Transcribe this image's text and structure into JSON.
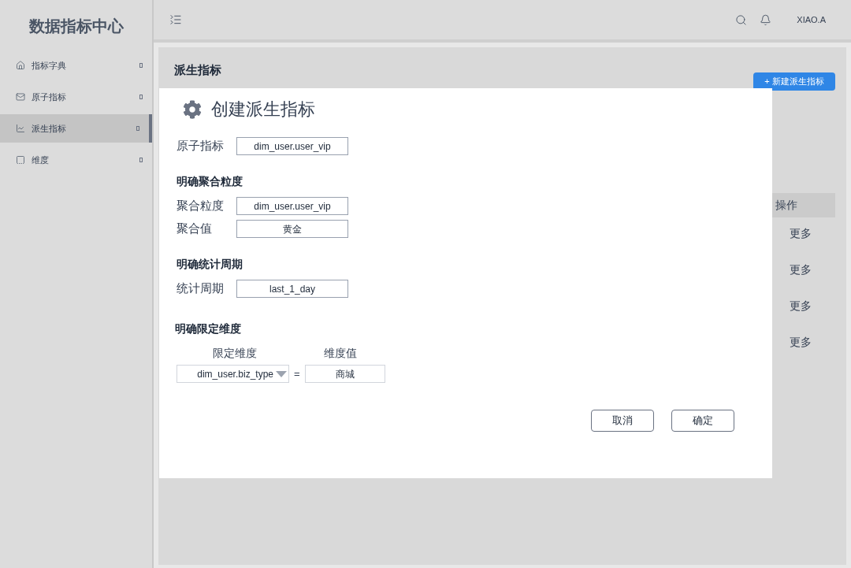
{
  "sidebar": {
    "title": "数据指标中心",
    "items": [
      {
        "label": "指标字典",
        "selected": false
      },
      {
        "label": "原子指标",
        "selected": false
      },
      {
        "label": "派生指标",
        "selected": true
      },
      {
        "label": "维度",
        "selected": false
      }
    ]
  },
  "header": {
    "user": "XIAO.A"
  },
  "page": {
    "title": "派生指标",
    "new_button": "+ 新建派生指标",
    "table": {
      "columns": [
        "操作"
      ],
      "rows": [
        {
          "action": "更多"
        },
        {
          "action": "更多"
        },
        {
          "action": "更多"
        },
        {
          "action": "更多"
        }
      ]
    }
  },
  "dialog": {
    "title": "创建派生指标",
    "atom": {
      "label": "原子指标",
      "value": "dim_user.user_vip"
    },
    "sections": [
      {
        "heading": "明确聚合粒度",
        "fields": [
          {
            "label": "聚合粒度",
            "value": "dim_user.user_vip"
          },
          {
            "label": "聚合值",
            "value": "黄金"
          }
        ]
      },
      {
        "heading": "明确统计周期",
        "fields": [
          {
            "label": "统计周期",
            "value": "last_1_day"
          }
        ]
      }
    ],
    "dimension": {
      "heading": "明确限定维度",
      "dim_label": "限定维度",
      "value_label": "维度值",
      "dim_value": "dim_user.biz_type",
      "operator": "=",
      "value": "商城"
    },
    "buttons": [
      "取消",
      "确定"
    ]
  }
}
